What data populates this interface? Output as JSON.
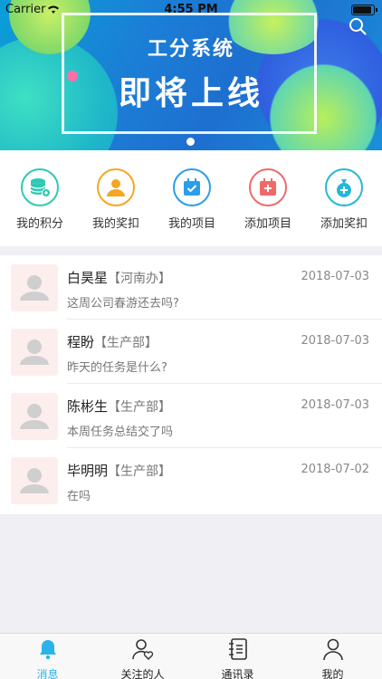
{
  "status": {
    "carrier": "Carrier",
    "time": "4:55 PM"
  },
  "banner": {
    "subtitle": "工分系统",
    "title": "即将上线"
  },
  "quick_menu": [
    {
      "label": "我的积分",
      "icon": "database-coin-icon",
      "color": "#2ec9b5"
    },
    {
      "label": "我的奖扣",
      "icon": "user-icon",
      "color": "#f5a623"
    },
    {
      "label": "我的项目",
      "icon": "calendar-check-icon",
      "color": "#2a9ee8"
    },
    {
      "label": "添加项目",
      "icon": "calendar-add-icon",
      "color": "#f06a6a"
    },
    {
      "label": "添加奖扣",
      "icon": "money-bag-add-icon",
      "color": "#25b8d6"
    }
  ],
  "messages": [
    {
      "name": "白昊星",
      "dept": "【河南办】",
      "date": "2018-07-03",
      "text": "这周公司春游还去吗?"
    },
    {
      "name": "程盼",
      "dept": "【生产部】",
      "date": "2018-07-03",
      "text": "昨天的任务是什么?"
    },
    {
      "name": "陈彬生",
      "dept": "【生产部】",
      "date": "2018-07-03",
      "text": "本周任务总结交了吗"
    },
    {
      "name": "毕明明",
      "dept": "【生产部】",
      "date": "2018-07-02",
      "text": "在吗"
    }
  ],
  "tabs": [
    {
      "label": "消息",
      "icon": "bell-icon"
    },
    {
      "label": "关注的人",
      "icon": "user-heart-icon"
    },
    {
      "label": "通讯录",
      "icon": "address-book-icon"
    },
    {
      "label": "我的",
      "icon": "person-icon"
    }
  ],
  "colors": {
    "accent": "#2bb3ea"
  }
}
